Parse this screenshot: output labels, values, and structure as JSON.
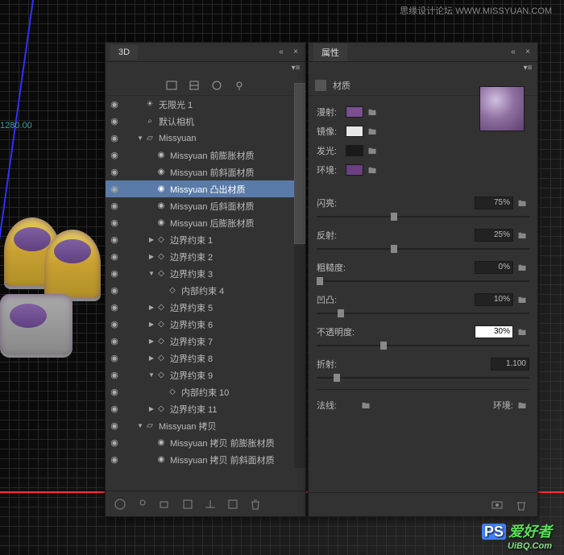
{
  "watermark": {
    "top": "思缘设计论坛  WWW.MISSYUAN.COM",
    "bottom_prefix": "PS",
    "bottom_main": "爱好者",
    "bottom_sub": "UiBQ.Com"
  },
  "panels": {
    "left": {
      "title": "3D"
    },
    "right": {
      "title": "属性"
    }
  },
  "props": {
    "section": "材质",
    "swatches": [
      {
        "label": "漫射:",
        "color": "#7a5090"
      },
      {
        "label": "镜像:",
        "color": "#e8e8e8"
      },
      {
        "label": "发光:",
        "color": "#1a1a1a"
      },
      {
        "label": "环境:",
        "color": "#6a4080"
      }
    ],
    "sliders": [
      {
        "label": "闪亮:",
        "value": "75%",
        "pos": 35,
        "folder": true
      },
      {
        "label": "反射:",
        "value": "25%",
        "pos": 35,
        "folder": true
      },
      {
        "label": "粗糙度:",
        "value": "0%",
        "pos": 0,
        "folder": true
      },
      {
        "label": "凹凸:",
        "value": "10%",
        "pos": 10,
        "folder": true
      },
      {
        "label": "不透明度:",
        "value": "30%",
        "pos": 30,
        "folder": true,
        "highlight": true
      },
      {
        "label": "折射:",
        "value": "1.100",
        "pos": 8,
        "folder": false
      }
    ],
    "normal_label": "法线:",
    "env_label": "环境:"
  },
  "tree": [
    {
      "icon": "light",
      "label": "无限光 1",
      "indent": 0,
      "tw": ""
    },
    {
      "icon": "camera",
      "label": "默认相机",
      "indent": 0,
      "tw": ""
    },
    {
      "icon": "mesh",
      "label": "Missyuan",
      "indent": 0,
      "tw": "▼"
    },
    {
      "icon": "mat",
      "label": "Missyuan 前膨胀材质",
      "indent": 1,
      "tw": ""
    },
    {
      "icon": "mat",
      "label": "Missyuan 前斜面材质",
      "indent": 1,
      "tw": ""
    },
    {
      "icon": "mat",
      "label": "Missyuan 凸出材质",
      "indent": 1,
      "tw": "",
      "selected": true
    },
    {
      "icon": "mat",
      "label": "Missyuan 后斜面材质",
      "indent": 1,
      "tw": ""
    },
    {
      "icon": "mat",
      "label": "Missyuan 后膨胀材质",
      "indent": 1,
      "tw": ""
    },
    {
      "icon": "con",
      "label": "边界约束 1",
      "indent": 1,
      "tw": "▶"
    },
    {
      "icon": "con",
      "label": "边界约束 2",
      "indent": 1,
      "tw": "▶"
    },
    {
      "icon": "con",
      "label": "边界约束 3",
      "indent": 1,
      "tw": "▼"
    },
    {
      "icon": "con",
      "label": "内部约束 4",
      "indent": 2,
      "tw": ""
    },
    {
      "icon": "con",
      "label": "边界约束 5",
      "indent": 1,
      "tw": "▶"
    },
    {
      "icon": "con",
      "label": "边界约束 6",
      "indent": 1,
      "tw": "▶"
    },
    {
      "icon": "con",
      "label": "边界约束 7",
      "indent": 1,
      "tw": "▶"
    },
    {
      "icon": "con",
      "label": "边界约束 8",
      "indent": 1,
      "tw": "▶"
    },
    {
      "icon": "con",
      "label": "边界约束 9",
      "indent": 1,
      "tw": "▼"
    },
    {
      "icon": "con",
      "label": "内部约束 10",
      "indent": 2,
      "tw": ""
    },
    {
      "icon": "con",
      "label": "边界约束 11",
      "indent": 1,
      "tw": "▶"
    },
    {
      "icon": "mesh",
      "label": "Missyuan 拷贝",
      "indent": 0,
      "tw": "▼"
    },
    {
      "icon": "mat",
      "label": "Missyuan 拷贝 前膨胀材质",
      "indent": 1,
      "tw": ""
    },
    {
      "icon": "mat",
      "label": "Missyuan 拷贝 前斜面材质",
      "indent": 1,
      "tw": ""
    }
  ],
  "viewport_label": "1280.00"
}
